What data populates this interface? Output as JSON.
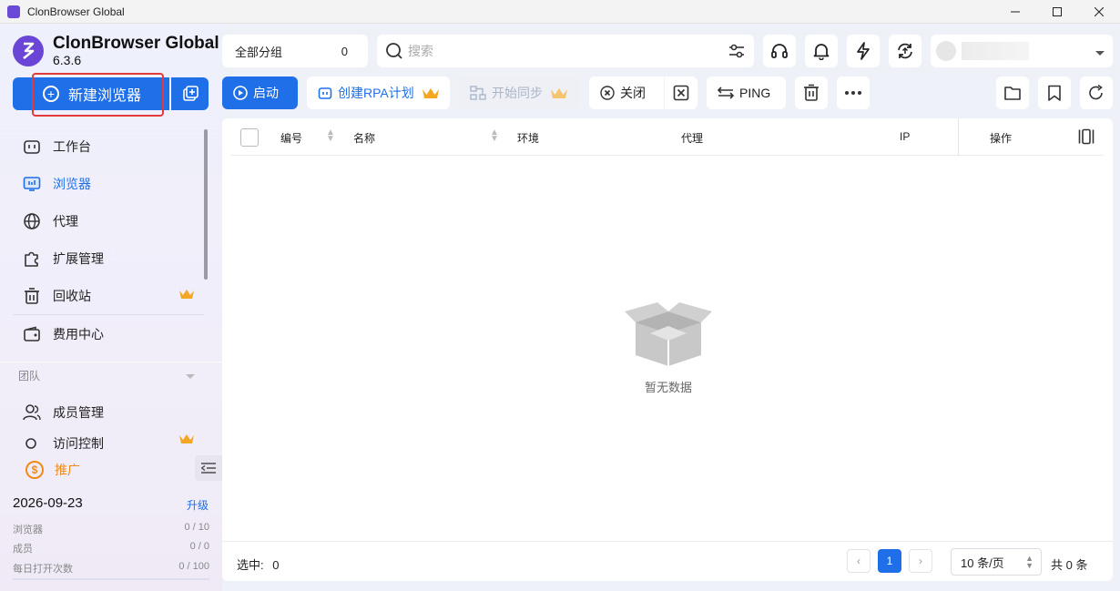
{
  "window": {
    "title": "ClonBrowser Global"
  },
  "brand": {
    "name": "ClonBrowser Global",
    "version": "6.3.6"
  },
  "sidebar": {
    "new_browser_label": "新建浏览器",
    "items": [
      {
        "label": "工作台",
        "icon": "dashboard-icon"
      },
      {
        "label": "浏览器",
        "icon": "browser-icon",
        "active": true
      },
      {
        "label": "代理",
        "icon": "globe-icon"
      },
      {
        "label": "扩展管理",
        "icon": "puzzle-icon"
      },
      {
        "label": "回收站",
        "icon": "trash-icon",
        "premium": true
      },
      {
        "label": "费用中心",
        "icon": "wallet-icon"
      }
    ],
    "team_label": "团队",
    "team_items": [
      {
        "label": "成员管理",
        "icon": "members-icon"
      },
      {
        "label": "访问控制",
        "icon": "access-icon",
        "premium": true
      }
    ],
    "promo_label": "推广",
    "expiry_date": "2026-09-23",
    "upgrade_label": "升级",
    "quotas": [
      {
        "label": "浏览器",
        "value": "0 / 10"
      },
      {
        "label": "成员",
        "value": "0 / 0"
      },
      {
        "label": "每日打开次数",
        "value": "0 / 100"
      }
    ]
  },
  "toolbar": {
    "group_label": "全部分组",
    "group_count": "0",
    "search_placeholder": "搜索"
  },
  "actions": {
    "start": "启动",
    "create_rpa": "创建RPA计划",
    "start_sync": "开始同步",
    "close": "关闭",
    "ping": "PING"
  },
  "table": {
    "columns": [
      "编号",
      "名称",
      "环境",
      "代理",
      "IP",
      "操作"
    ],
    "empty_text": "暂无数据"
  },
  "footer": {
    "selected_label": "选中:",
    "selected_count": "0",
    "current_page": "1",
    "per_page": "10 条/页",
    "total": "共 0 条"
  },
  "colors": {
    "primary": "#1f6fe8",
    "brand": "#6b46d6",
    "crown": "#f5a623",
    "promo": "#f08a18"
  }
}
